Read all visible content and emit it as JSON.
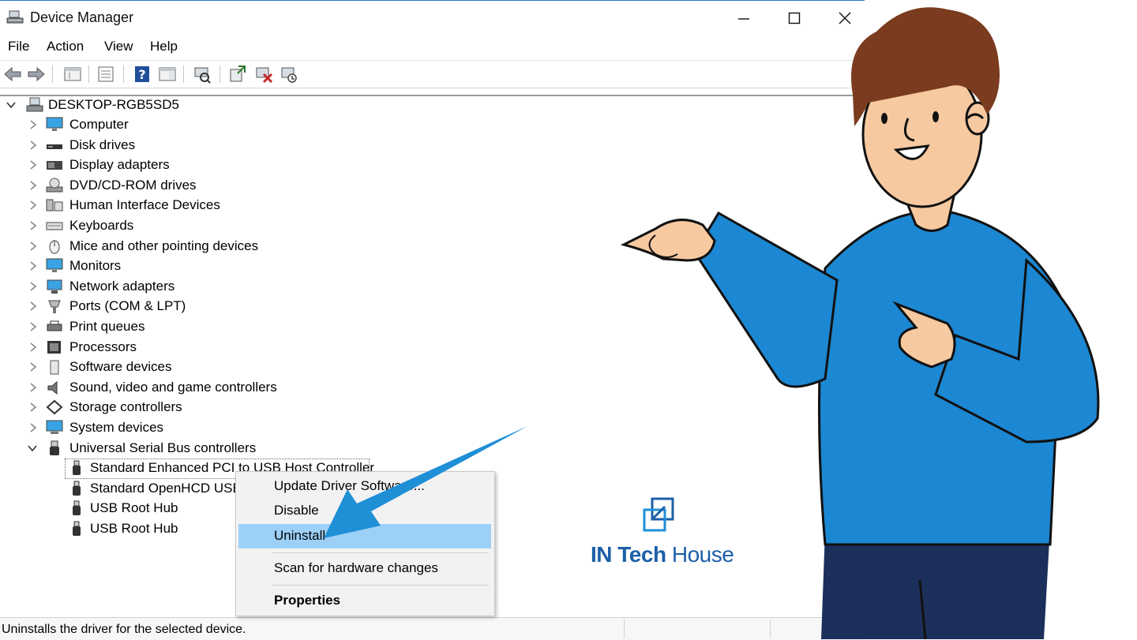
{
  "window": {
    "title": "Device Manager"
  },
  "menu": [
    "File",
    "Action",
    "View",
    "Help"
  ],
  "tree": {
    "root": "DESKTOP-RGB5SD5",
    "categories": [
      {
        "label": "Computer",
        "icon": "monitor-icon"
      },
      {
        "label": "Disk drives",
        "icon": "disk-drive-icon"
      },
      {
        "label": "Display adapters",
        "icon": "display-adapter-icon"
      },
      {
        "label": "DVD/CD-ROM drives",
        "icon": "dvd-drive-icon"
      },
      {
        "label": "Human Interface Devices",
        "icon": "hid-icon"
      },
      {
        "label": "Keyboards",
        "icon": "keyboard-icon"
      },
      {
        "label": "Mice and other pointing devices",
        "icon": "mouse-icon"
      },
      {
        "label": "Monitors",
        "icon": "monitor-icon"
      },
      {
        "label": "Network adapters",
        "icon": "network-adapter-icon"
      },
      {
        "label": "Ports (COM & LPT)",
        "icon": "port-icon"
      },
      {
        "label": "Print queues",
        "icon": "printer-icon"
      },
      {
        "label": "Processors",
        "icon": "processor-icon"
      },
      {
        "label": "Software devices",
        "icon": "software-device-icon"
      },
      {
        "label": "Sound, video and game controllers",
        "icon": "speaker-icon"
      },
      {
        "label": "Storage controllers",
        "icon": "storage-controller-icon"
      },
      {
        "label": "System devices",
        "icon": "system-device-icon"
      },
      {
        "label": "Universal Serial Bus controllers",
        "icon": "usb-icon"
      }
    ],
    "usb_children": [
      "Standard Enhanced PCI to USB Host Controller",
      "Standard OpenHCD USB",
      "USB Root Hub",
      "USB Root Hub"
    ]
  },
  "context_menu": {
    "update": "Update Driver Software...",
    "disable": "Disable",
    "uninstall": "Uninstall",
    "scan": "Scan for hardware changes",
    "properties": "Properties"
  },
  "status_text": "Uninstalls the driver for the selected device.",
  "logo": {
    "brand_bold": "IN Tech",
    "brand_light": " House"
  },
  "colors": {
    "accent": "#1f8fd6",
    "highlight": "#9dd0f7",
    "brand": "#1c5fa8",
    "shirt": "#1c87d2",
    "pants": "#1b2f5a"
  }
}
